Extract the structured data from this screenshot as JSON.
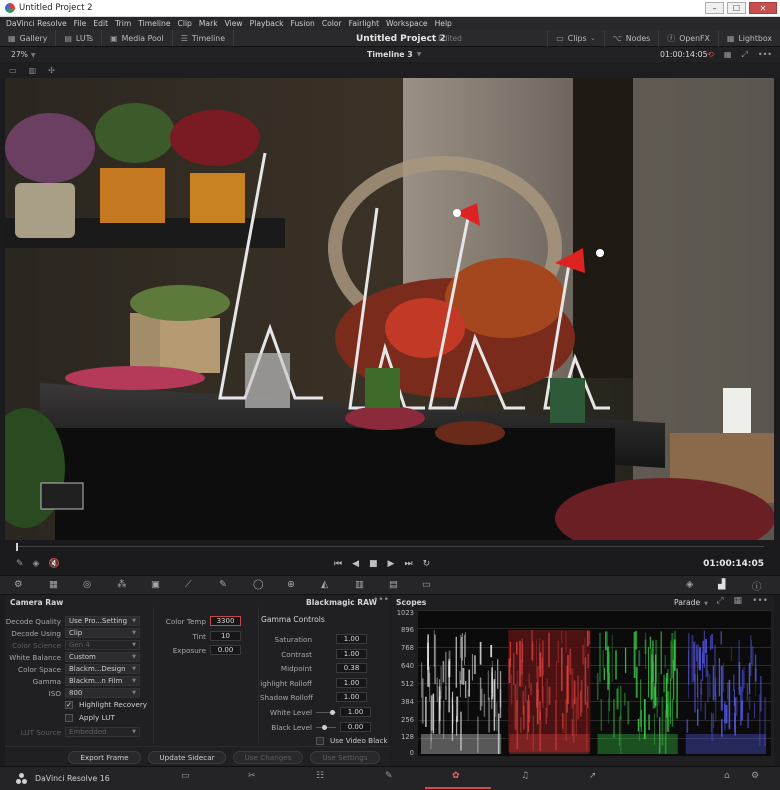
{
  "window": {
    "title": "Untitled Project 2",
    "min": "–",
    "max": "☐",
    "close": "✕"
  },
  "menu": [
    "DaVinci Resolve",
    "File",
    "Edit",
    "Trim",
    "Timeline",
    "Clip",
    "Mark",
    "View",
    "Playback",
    "Fusion",
    "Color",
    "Fairlight",
    "Workspace",
    "Help"
  ],
  "toolbar": {
    "gallery": "Gallery",
    "luts": "LUTs",
    "media_pool": "Media Pool",
    "timeline": "Timeline",
    "project_title": "Untitled Project 2",
    "project_status": "Edited",
    "clips": "Clips",
    "nodes": "Nodes",
    "openfx": "OpenFX",
    "lightbox": "Lightbox"
  },
  "viewer": {
    "zoom": "27%",
    "timeline_name": "Timeline 3",
    "timecode": "01:00:14:05"
  },
  "transport": {
    "timecode": "01:00:14:05"
  },
  "camera_raw": {
    "title": "Camera Raw",
    "raw_format": "Blackmagic RAW",
    "fields": [
      {
        "label": "Decode Quality",
        "value": "Use Pro...Setting",
        "dim": false
      },
      {
        "label": "Decode Using",
        "value": "Clip",
        "dim": false
      },
      {
        "label": "Color Science",
        "value": "Gen 4",
        "dim": true
      },
      {
        "label": "White Balance",
        "value": "Custom",
        "dim": false
      },
      {
        "label": "Color Space",
        "value": "Blackm...Design",
        "dim": false
      },
      {
        "label": "Gamma",
        "value": "Blackm...n Film",
        "dim": false
      },
      {
        "label": "ISO",
        "value": "800",
        "dim": false
      }
    ],
    "highlight_recovery": "Highlight Recovery",
    "apply_lut": "Apply LUT",
    "lut_source_label": "LUT Source",
    "lut_source_value": "Embedded",
    "color_temp_label": "Color Temp",
    "color_temp": "3300",
    "tint_label": "Tint",
    "tint": "10",
    "exposure_label": "Exposure",
    "exposure": "0.00",
    "gamma_controls": "Gamma Controls",
    "gamma_fields": [
      {
        "label": "Saturation",
        "value": "1.00"
      },
      {
        "label": "Contrast",
        "value": "1.00"
      },
      {
        "label": "Midpoint",
        "value": "0.38"
      },
      {
        "label": "Highlight Rolloff",
        "value": "1.00"
      },
      {
        "label": "Shadow Rolloff",
        "value": "1.00"
      }
    ],
    "white_level_label": "White Level",
    "white_level": "1.00",
    "black_level_label": "Black Level",
    "black_level": "0.00",
    "use_video_black": "Use Video Black",
    "buttons": {
      "export_frame": "Export Frame",
      "update_sidecar": "Update Sidecar",
      "use_changes": "Use Changes",
      "use_settings": "Use Settings"
    }
  },
  "scopes": {
    "title": "Scopes",
    "mode": "Parade",
    "scale": [
      "1023",
      "896",
      "768",
      "640",
      "512",
      "384",
      "256",
      "128",
      "0"
    ],
    "channel_colors": [
      "#e8e8e8",
      "#e04040",
      "#3ad04a",
      "#5a5cf0"
    ]
  },
  "pagebar": {
    "brand": "DaVinci Resolve 16"
  }
}
